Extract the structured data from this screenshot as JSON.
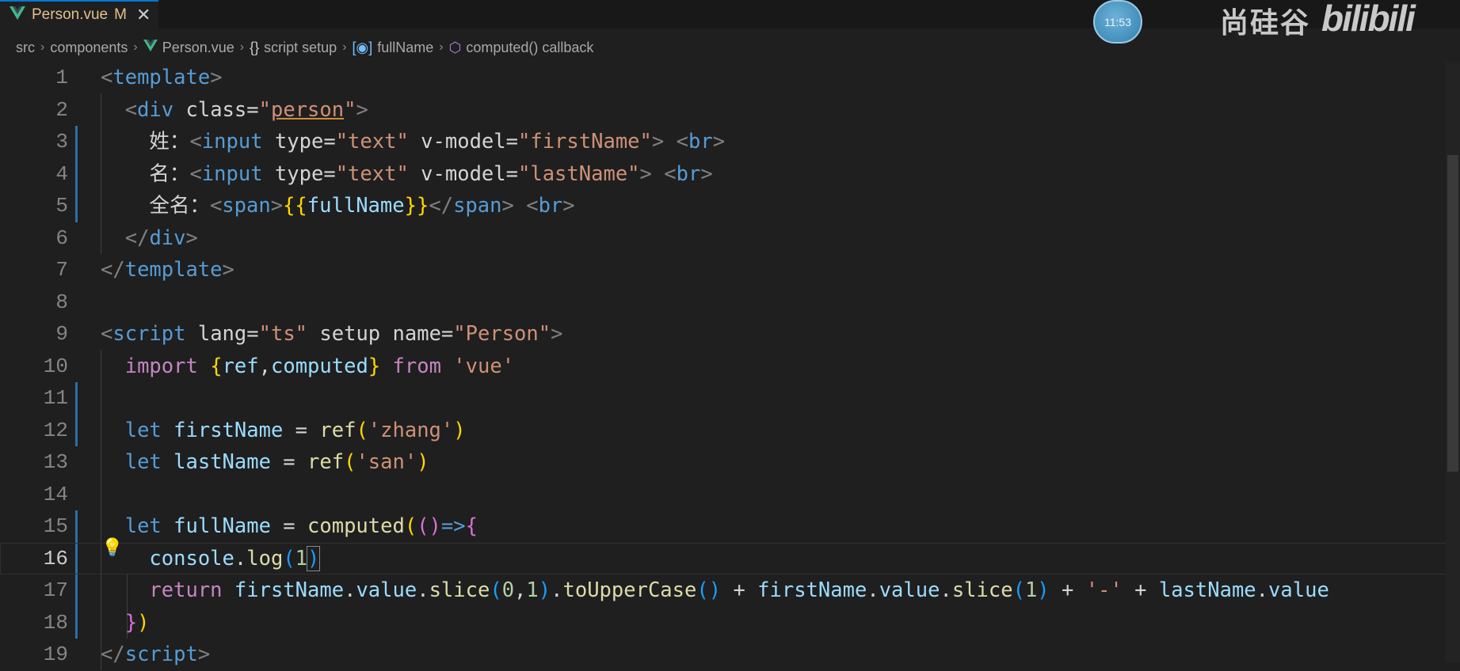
{
  "tab": {
    "filename": "Person.vue",
    "status": "M"
  },
  "breadcrumb": [
    "src",
    "components",
    "Person.vue",
    "script setup",
    "fullName",
    "computed() callback"
  ],
  "overlay": {
    "clock": "11:53",
    "watermark": "尚硅谷",
    "brand": "bilibili"
  },
  "editor": {
    "current_line": 16,
    "lines": [
      {
        "n": "1"
      },
      {
        "n": "2"
      },
      {
        "n": "3"
      },
      {
        "n": "4"
      },
      {
        "n": "5"
      },
      {
        "n": "6"
      },
      {
        "n": "7"
      },
      {
        "n": "8"
      },
      {
        "n": "9"
      },
      {
        "n": "10"
      },
      {
        "n": "11"
      },
      {
        "n": "12"
      },
      {
        "n": "13"
      },
      {
        "n": "14"
      },
      {
        "n": "15"
      },
      {
        "n": "16"
      },
      {
        "n": "17"
      },
      {
        "n": "18"
      },
      {
        "n": "19"
      }
    ],
    "code": {
      "l1": [
        "<",
        "template",
        ">"
      ],
      "l2": [
        "<",
        "div",
        " class",
        "=",
        "\"",
        "person",
        "\"",
        ">"
      ],
      "l3": [
        "姓：",
        "<",
        "input",
        " type",
        "=",
        "\"text\"",
        " v-model",
        "=",
        "\"firstName\"",
        ">",
        " ",
        "<",
        "br",
        ">"
      ],
      "l4": [
        "名：",
        "<",
        "input",
        " type",
        "=",
        "\"text\"",
        " v-model",
        "=",
        "\"lastName\"",
        ">",
        " ",
        "<",
        "br",
        ">"
      ],
      "l5": [
        "全名：",
        "<",
        "span",
        ">",
        "{{",
        "fullName",
        "}}",
        "</",
        "span",
        ">",
        " ",
        "<",
        "br",
        ">"
      ],
      "l6": [
        "</",
        "div",
        ">"
      ],
      "l7": [
        "</",
        "template",
        ">"
      ],
      "l9": [
        "<",
        "script",
        " lang",
        "=",
        "\"ts\"",
        " setup",
        " name",
        "=",
        "\"Person\"",
        ">"
      ],
      "l10": [
        "import",
        " ",
        "{",
        "ref",
        ",",
        "computed",
        "}",
        " from",
        " ",
        "'vue'"
      ],
      "l12": [
        "let",
        " firstName",
        " = ",
        "ref",
        "(",
        "'zhang'",
        ")"
      ],
      "l13": [
        "let",
        " lastName",
        " = ",
        "ref",
        "(",
        "'san'",
        ")"
      ],
      "l15": [
        "let",
        " fullName",
        " = ",
        "computed",
        "(",
        "()",
        "=>",
        "{"
      ],
      "l16": [
        "console",
        ".",
        "log",
        "(",
        "1",
        ")"
      ],
      "l17": [
        "return",
        " firstName",
        ".",
        "value",
        ".",
        "slice",
        "(",
        "0",
        ",",
        "1",
        ")",
        ".",
        "toUpperCase",
        "()",
        " + ",
        "firstName",
        ".",
        "value",
        ".",
        "slice",
        "(",
        "1",
        ")",
        " + ",
        "'-'",
        " + ",
        "lastName",
        ".",
        "value"
      ],
      "l18": [
        "}",
        ")"
      ],
      "l19": [
        "</",
        "script",
        ">"
      ]
    }
  }
}
